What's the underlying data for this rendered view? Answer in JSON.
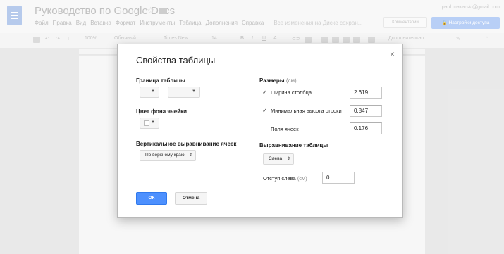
{
  "header": {
    "doc_title": "Руководство по Google Docs",
    "user_email": "paul.makarski@gmail.com",
    "comments_label": "Комментарии",
    "share_label": "Настройки доступа"
  },
  "menu": {
    "items": [
      "Файл",
      "Правка",
      "Вид",
      "Вставка",
      "Формат",
      "Инструменты",
      "Таблица",
      "Дополнения",
      "Справка"
    ],
    "save_status": "Все изменения на Диске сохран..."
  },
  "toolbar": {
    "zoom": "100%",
    "style": "Обычный ...",
    "font": "Times New ...",
    "size": "14",
    "bold": "B",
    "italic": "I",
    "underline": "U",
    "text_color": "A",
    "more": "Дополнительно"
  },
  "dialog": {
    "title": "Свойства таблицы",
    "close": "×",
    "border_section": "Граница таблицы",
    "bg_section": "Цвет фона ячейки",
    "valign_section": "Вертикальное выравнивание ячеек",
    "valign_value": "По верхнему краю",
    "sizes_section": "Размеры",
    "sizes_unit": "(см)",
    "col_width_label": "Ширина столбца",
    "col_width_checked": true,
    "col_width_value": "2.619",
    "min_height_label": "Минимальная высота строки",
    "min_height_checked": true,
    "min_height_value": "0.847",
    "padding_label": "Поля ячеек",
    "padding_value": "0.176",
    "align_section": "Выравнивание таблицы",
    "align_value": "Слева",
    "indent_label": "Отступ слева",
    "indent_unit": "(см)",
    "indent_value": "0",
    "ok_label": "ОК",
    "cancel_label": "Отмена"
  }
}
